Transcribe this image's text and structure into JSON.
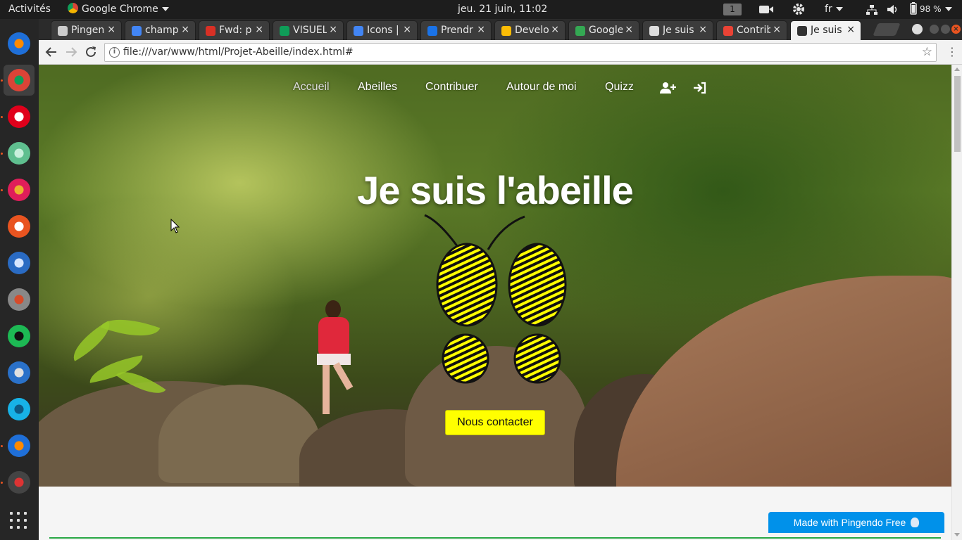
{
  "system_bar": {
    "activities": "Activités",
    "app_menu": "Google Chrome",
    "clock": "jeu. 21 juin, 11:02",
    "workspace": "1",
    "language": "fr",
    "battery": "98 %"
  },
  "dock": {
    "apps": [
      {
        "name": "firefox",
        "color": "#1f6fd8",
        "accent": "#ff8a00",
        "running": false
      },
      {
        "name": "chrome",
        "color": "#db4437",
        "accent": "#0f9d58",
        "running": true
      },
      {
        "name": "opera",
        "color": "#e0001b",
        "accent": "#ffffff",
        "running": true
      },
      {
        "name": "atom",
        "color": "#5fbf8f",
        "accent": "#c8f0dc",
        "running": true
      },
      {
        "name": "slack",
        "color": "#e01e5a",
        "accent": "#ecb22e",
        "running": true
      },
      {
        "name": "software-center",
        "color": "#e95420",
        "accent": "#ffffff",
        "running": false
      },
      {
        "name": "thunderbird",
        "color": "#2a6bc3",
        "accent": "#d7e6ff",
        "running": false
      },
      {
        "name": "settings",
        "color": "#888888",
        "accent": "#d64b2a",
        "running": false
      },
      {
        "name": "spotify",
        "color": "#1db954",
        "accent": "#111111",
        "running": false
      },
      {
        "name": "web-browser",
        "color": "#2a71c9",
        "accent": "#e0e0e0",
        "running": false
      },
      {
        "name": "kodi",
        "color": "#17b2e7",
        "accent": "#0d5a85",
        "running": false
      },
      {
        "name": "firefox-2",
        "color": "#1f6fd8",
        "accent": "#ff8a00",
        "running": true
      },
      {
        "name": "blocked-app",
        "color": "#444444",
        "accent": "#d33",
        "running": true
      }
    ]
  },
  "browser": {
    "tabs": [
      {
        "label": "Pingendo",
        "favicon_color": "#cccccc"
      },
      {
        "label": "champ",
        "favicon_color": "#4285f4"
      },
      {
        "label": "Fwd: p",
        "favicon_color": "#d93025"
      },
      {
        "label": "VISUEL",
        "favicon_color": "#0f9d58"
      },
      {
        "label": "Icons |",
        "favicon_color": "#4285f4"
      },
      {
        "label": "Prendr",
        "favicon_color": "#1a73e8"
      },
      {
        "label": "Develo",
        "favicon_color": "#fbbc05"
      },
      {
        "label": "Google",
        "favicon_color": "#34a853"
      },
      {
        "label": "Je suis",
        "favicon_color": "#dddddd"
      },
      {
        "label": "Contrib",
        "favicon_color": "#ea4335"
      },
      {
        "label": "Je suis",
        "favicon_color": "#333333"
      }
    ],
    "active_tab": 10,
    "url": "file:///var/www/html/Projet-Abeille/index.html#"
  },
  "page": {
    "nav": {
      "items": [
        "Accueil",
        "Abeilles",
        "Contribuer",
        "Autour de moi",
        "Quizz"
      ],
      "current": "Accueil",
      "icons": [
        "user-plus-icon",
        "sign-in-icon"
      ]
    },
    "hero": {
      "title": "Je suis l'abeille",
      "cta_label": "Nous contacter",
      "logo_colors": {
        "yellow": "#ffff00",
        "black": "#111111"
      }
    },
    "badge": "Made with Pingendo Free"
  }
}
